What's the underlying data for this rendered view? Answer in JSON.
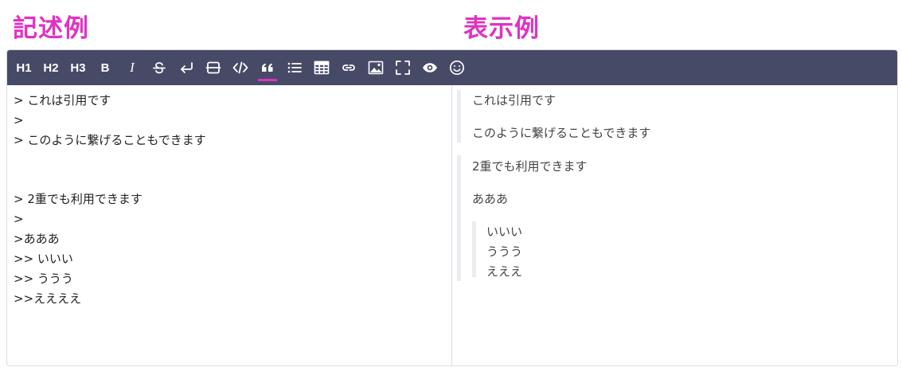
{
  "headings": {
    "left": "記述例",
    "right": "表示例"
  },
  "colors": {
    "accent": "#e032c4",
    "toolbar_bg": "#474a66",
    "quote_bar": "#ececf0"
  },
  "toolbar": {
    "items": [
      {
        "label": "H1",
        "icon": "heading-1"
      },
      {
        "label": "H2",
        "icon": "heading-2"
      },
      {
        "label": "H3",
        "icon": "heading-3"
      },
      {
        "label": "B",
        "icon": "bold"
      },
      {
        "label": "I",
        "icon": "italic"
      },
      {
        "label": "",
        "icon": "strikethrough-icon"
      },
      {
        "label": "",
        "icon": "line-break-icon"
      },
      {
        "label": "",
        "icon": "horizontal-rule-icon"
      },
      {
        "label": "",
        "icon": "code-icon"
      },
      {
        "label": "",
        "icon": "quote-icon",
        "active": true
      },
      {
        "label": "",
        "icon": "list-icon"
      },
      {
        "label": "",
        "icon": "table-icon"
      },
      {
        "label": "",
        "icon": "link-icon"
      },
      {
        "label": "",
        "icon": "image-icon"
      },
      {
        "label": "",
        "icon": "fullscreen-icon"
      },
      {
        "label": "",
        "icon": "preview-eye-icon"
      },
      {
        "label": "",
        "icon": "emoji-icon"
      }
    ]
  },
  "source": {
    "lines": [
      "> これは引用です",
      ">",
      "> このように繋げることもできます",
      "",
      "",
      "> 2重でも利用できます",
      ">",
      ">あああ",
      ">> いいい",
      ">> ううう",
      ">>ええええ"
    ]
  },
  "preview": {
    "quote1": {
      "line1": "これは引用です",
      "line2": "このように繋げることもできます"
    },
    "quote2": {
      "line1": "2重でも利用できます",
      "line2": "あああ",
      "nested": {
        "line1": "いいい",
        "line2": "ううう",
        "line3": "えええ"
      }
    }
  }
}
